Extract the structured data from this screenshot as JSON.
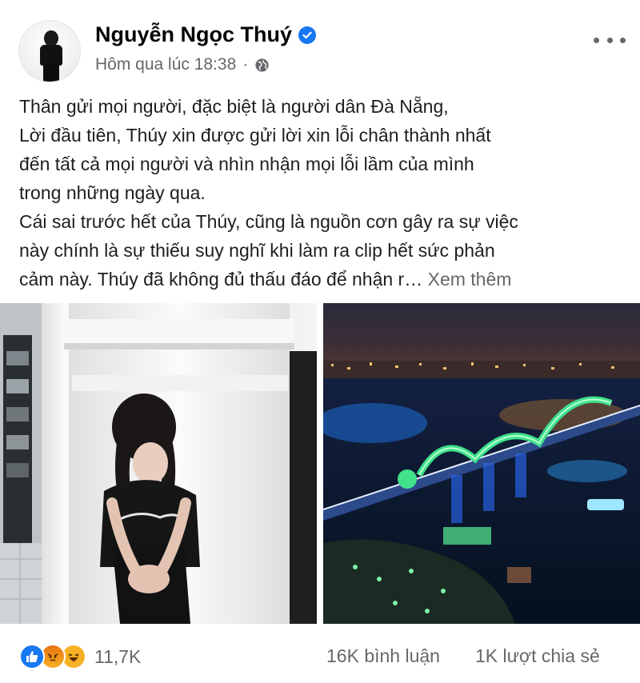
{
  "post": {
    "author": "Nguyễn Ngọc Thuý",
    "timestamp": "Hôm qua lúc 18:38",
    "timestamp_separator": "·",
    "audience_icon": "globe-icon",
    "verified_icon": "verified-badge-icon",
    "more_icon": "more-options-icon",
    "body_lines": [
      "Thân gửi mọi người, đặc biệt là người dân Đà Nẵng,",
      "Lời đầu tiên, Thúy xin được gửi lời xin lỗi chân thành nhất",
      "đến tất cả mọi người và nhìn nhận mọi lỗi lầm của mình",
      "trong những ngày qua.",
      "Cái sai trước hết của Thúy, cũng là nguồn cơn gây ra sự việc",
      "này chính là sự thiếu suy nghĩ khi làm ra clip hết sức phản",
      "cảm này. Thúy đã không đủ thấu đáo để nhận r… "
    ],
    "see_more": "Xem thêm"
  },
  "photos": [
    {
      "name": "photo-woman-bowing"
    },
    {
      "name": "photo-dragon-bridge-night"
    }
  ],
  "stats": {
    "reactions": [
      "like-icon",
      "angry-icon",
      "haha-icon"
    ],
    "reaction_count": "11,7K",
    "comments": "16K bình luận",
    "shares": "1K lượt chia sẻ"
  },
  "colors": {
    "accent": "#1877f2",
    "secondary_text": "#65676b",
    "primary_text": "#1c1e21"
  }
}
